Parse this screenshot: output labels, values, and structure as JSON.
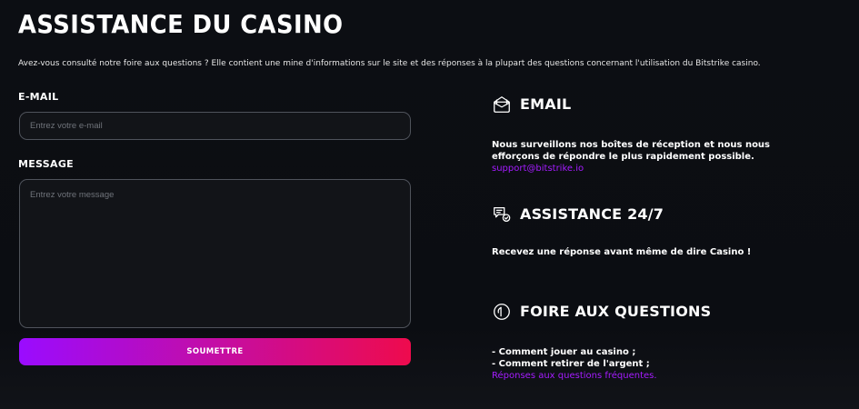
{
  "header": {
    "title": "ASSISTANCE DU CASINO",
    "intro": "Avez-vous consulté notre foire aux questions ? Elle contient une mine d'informations sur le site et des réponses à la plupart des questions concernant l'utilisation du Bitstrike casino."
  },
  "form": {
    "email_label": "E-MAIL",
    "email_placeholder": "Entrez votre e-mail",
    "email_value": "",
    "message_label": "MESSAGE",
    "message_placeholder": "Entrez votre message",
    "message_value": "",
    "submit_label": "SOUMETTRE"
  },
  "info": {
    "email": {
      "icon": "mail-inbox-icon",
      "title": "EMAIL",
      "text": "Nous surveillons nos boîtes de réception et nous nous efforçons de répondre le plus rapidement possible.",
      "link": "support@bitstrike.io"
    },
    "assistance": {
      "icon": "chat-support-icon",
      "title": "ASSISTANCE 24/7",
      "text": "Recevez une réponse avant même de dire Casino !"
    },
    "faq": {
      "icon": "faq-icon",
      "title": "FOIRE AUX QUESTIONS",
      "line1": "- Comment jouer au casino ;",
      "line2": "- Comment retirer de l'argent ;",
      "link": "Réponses aux questions fréquentes."
    }
  },
  "colors": {
    "background": "#0c0e13",
    "accent_purple": "#a51cff",
    "accent_pink": "#ee0b4d",
    "input_border": "#4f535b"
  }
}
